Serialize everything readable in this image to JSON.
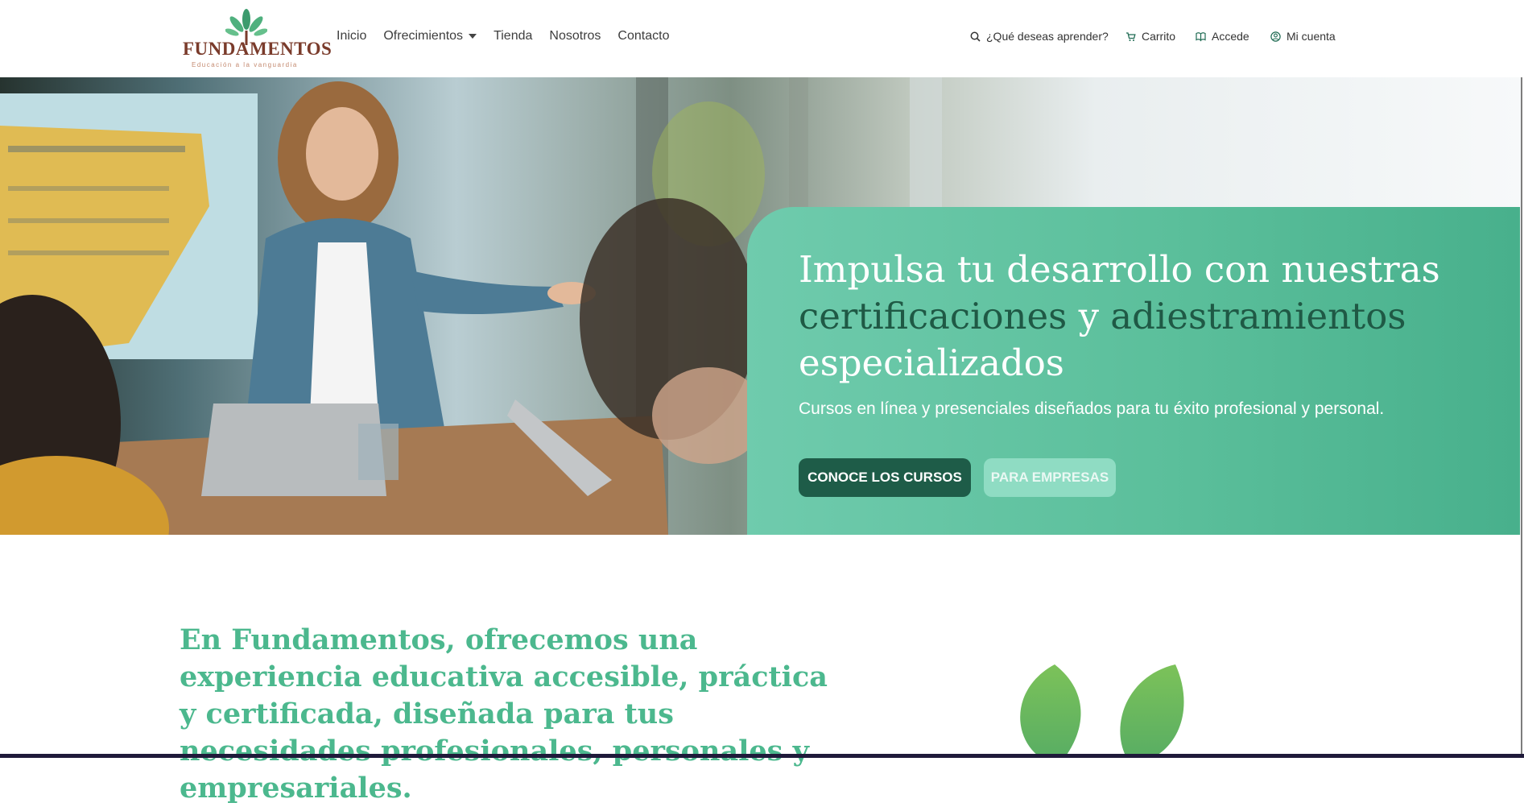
{
  "brand": {
    "name": "FUNDAMENTOS",
    "tagline": "Educación a la vanguardia",
    "colors": {
      "wordmark": "#7a3b2b",
      "leaf": "#3c9b6e",
      "accent": "#4cb88e",
      "dark_accent": "#1e5c48"
    }
  },
  "nav": {
    "items": [
      {
        "label": "Inicio"
      },
      {
        "label": "Ofrecimientos",
        "has_dropdown": true
      },
      {
        "label": "Tienda"
      },
      {
        "label": "Nosotros"
      },
      {
        "label": "Contacto"
      }
    ]
  },
  "utility": {
    "search": {
      "label": "¿Qué deseas aprender?",
      "icon": "search-icon"
    },
    "cart": {
      "label": "Carrito",
      "icon": "cart-icon"
    },
    "login": {
      "label": "Accede",
      "icon": "book-icon"
    },
    "account": {
      "label": "Mi cuenta",
      "icon": "user-icon"
    }
  },
  "hero": {
    "title_part1": "Impulsa tu desarrollo con nuestras ",
    "title_highlight1": "certificaciones",
    "title_part2": " y ",
    "title_highlight2": "adiestramientos",
    "title_part3": " especializados",
    "subtitle": "Cursos en línea y presenciales diseñados para tu éxito profesional y personal.",
    "primary_button": "CONOCE LOS CURSOS",
    "secondary_button": "PARA EMPRESAS"
  },
  "intro": {
    "text": "En Fundamentos, ofrecemos una experiencia educativa accesible, práctica y certificada, diseñada para tus necesidades profesionales, personales y empresariales."
  }
}
